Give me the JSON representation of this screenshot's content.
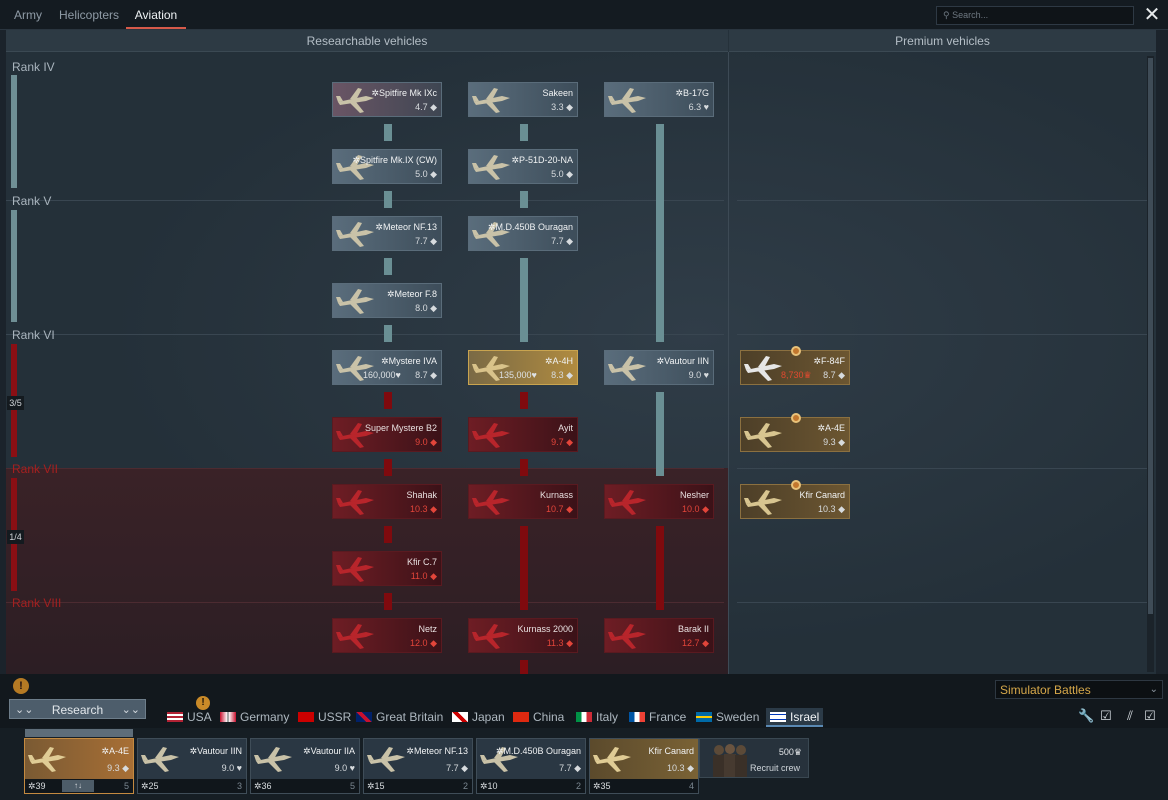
{
  "top_tabs": [
    "Army",
    "Helicopters",
    "Aviation"
  ],
  "active_tab": "Aviation",
  "search": {
    "placeholder": "Search..."
  },
  "close_label": "✕",
  "headers": {
    "researchable": "Researchable vehicles",
    "premium": "Premium vehicles"
  },
  "ranks": [
    {
      "label": "Rank IV",
      "progress": ""
    },
    {
      "label": "Rank V",
      "progress": ""
    },
    {
      "label": "Rank VI",
      "progress": "3/5"
    },
    {
      "label": "Rank VII",
      "progress": "1/4"
    },
    {
      "label": "Rank VIII",
      "progress": ""
    }
  ],
  "tree": [
    {
      "name": "✲Spitfire Mk IXc",
      "br": "4.7 ◆",
      "rp": "",
      "state": "pink"
    },
    {
      "name": "Sakeen",
      "br": "3.3 ◆",
      "rp": "",
      "state": "res"
    },
    {
      "name": "✲B-17G",
      "br": "6.3 ♥",
      "rp": "",
      "state": "res"
    },
    {
      "name": "✲Spitfire Mk.IX (CW)",
      "br": "5.0 ◆",
      "rp": "",
      "state": "res"
    },
    {
      "name": "✲P-51D-20-NA",
      "br": "5.0 ◆",
      "rp": "",
      "state": "res"
    },
    {
      "name": "✲Meteor NF.13",
      "br": "7.7 ◆",
      "rp": "",
      "state": "res"
    },
    {
      "name": "✲M.D.450B Ouragan",
      "br": "7.7 ◆",
      "rp": "",
      "state": "res"
    },
    {
      "name": "✲Meteor F.8",
      "br": "8.0 ◆",
      "rp": "",
      "state": "res"
    },
    {
      "name": "✲Mystere IVA",
      "br": "8.7 ◆",
      "rp": "160,000♥",
      "state": "res"
    },
    {
      "name": "✲A-4H",
      "br": "8.3 ◆",
      "rp": "135,000♥",
      "state": "sel"
    },
    {
      "name": "✲Vautour IIN",
      "br": "9.0 ♥",
      "rp": "",
      "state": "res"
    },
    {
      "name": "Super Mystere B2",
      "br": "9.0 ◆",
      "rp": "",
      "state": "loc"
    },
    {
      "name": "Ayit",
      "br": "9.7 ◆",
      "rp": "",
      "state": "loc"
    },
    {
      "name": "Shahak",
      "br": "10.3 ◆",
      "rp": "",
      "state": "loc"
    },
    {
      "name": "Kurnass",
      "br": "10.7 ◆",
      "rp": "",
      "state": "loc"
    },
    {
      "name": "Nesher",
      "br": "10.0 ◆",
      "rp": "",
      "state": "loc"
    },
    {
      "name": "Kfir C.7",
      "br": "11.0 ◆",
      "rp": "",
      "state": "loc"
    },
    {
      "name": "Netz",
      "br": "12.0 ◆",
      "rp": "",
      "state": "loc"
    },
    {
      "name": "Kurnass 2000",
      "br": "11.3 ◆",
      "rp": "",
      "state": "loc"
    },
    {
      "name": "Barak II",
      "br": "12.7 ◆",
      "rp": "",
      "state": "loc"
    }
  ],
  "premium": [
    {
      "name": "✲F-84F",
      "br": "8.7 ◆",
      "rp": "8,730♛"
    },
    {
      "name": "✲A-4E",
      "br": "9.3 ◆",
      "rp": ""
    },
    {
      "name": "Kfir Canard",
      "br": "10.3 ◆",
      "rp": ""
    }
  ],
  "game_mode": "Simulator Battles",
  "research_label": "Research",
  "countries": [
    "USA",
    "Germany",
    "USSR",
    "Great Britain",
    "Japan",
    "China",
    "Italy",
    "France",
    "Sweden",
    "Israel"
  ],
  "active_country": "Israel",
  "crew_slots": [
    {
      "name": "✲A-4E",
      "br": "9.3 ◆",
      "crew": "39",
      "spare": "5",
      "swap": "↑↓"
    },
    {
      "name": "✲Vautour IIN",
      "br": "9.0 ♥",
      "crew": "25",
      "spare": "3",
      "swap": ""
    },
    {
      "name": "✲Vautour IIA",
      "br": "9.0 ♥",
      "crew": "36",
      "spare": "5",
      "swap": ""
    },
    {
      "name": "✲Meteor NF.13",
      "br": "7.7 ◆",
      "crew": "15",
      "spare": "2",
      "swap": ""
    },
    {
      "name": "✲M.D.450B Ouragan",
      "br": "7.7 ◆",
      "crew": "10",
      "spare": "2",
      "swap": ""
    },
    {
      "name": "Kfir Canard",
      "br": "10.3 ◆",
      "crew": "35",
      "spare": "4",
      "swap": ""
    }
  ],
  "recruit": {
    "cost": "500♛",
    "label": "Recruit crew"
  },
  "colors": {
    "accent": "#d65a4a",
    "locked": "#7f0a0e",
    "selected": "#b08b40",
    "mode_text": "#d6a84a"
  }
}
